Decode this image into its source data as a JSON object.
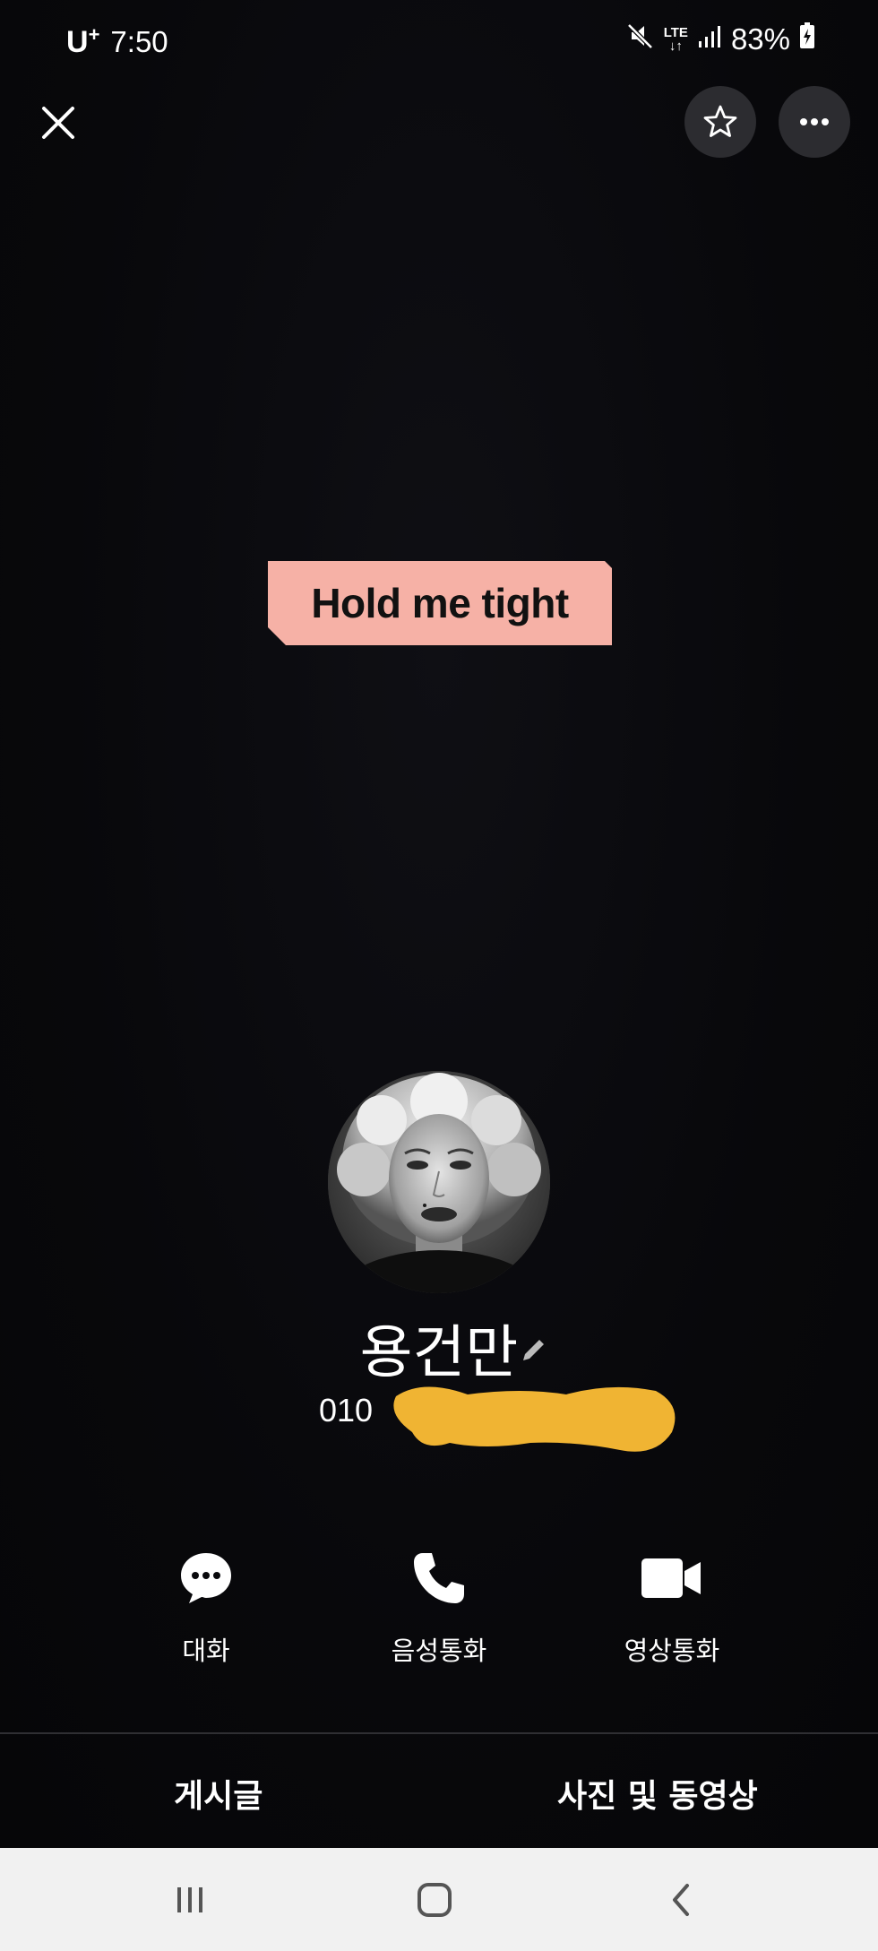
{
  "status_bar": {
    "carrier": "U",
    "carrier_sup": "+",
    "time": "7:50",
    "network": "LTE",
    "battery": "83%"
  },
  "sticker": {
    "text": "Hold me tight",
    "color": "#f6b1a6"
  },
  "profile": {
    "name": "용건만",
    "phone_visible": "010  ",
    "redaction_color": "#f0b433"
  },
  "actions": [
    {
      "label": "대화",
      "icon": "chat-bubble-icon"
    },
    {
      "label": "음성통화",
      "icon": "phone-icon"
    },
    {
      "label": "영상통화",
      "icon": "video-camera-icon"
    }
  ],
  "tabs": [
    {
      "label": "게시글"
    },
    {
      "label": "사진 및 동영상"
    }
  ],
  "nav": [
    "recents-icon",
    "home-icon",
    "back-icon"
  ]
}
